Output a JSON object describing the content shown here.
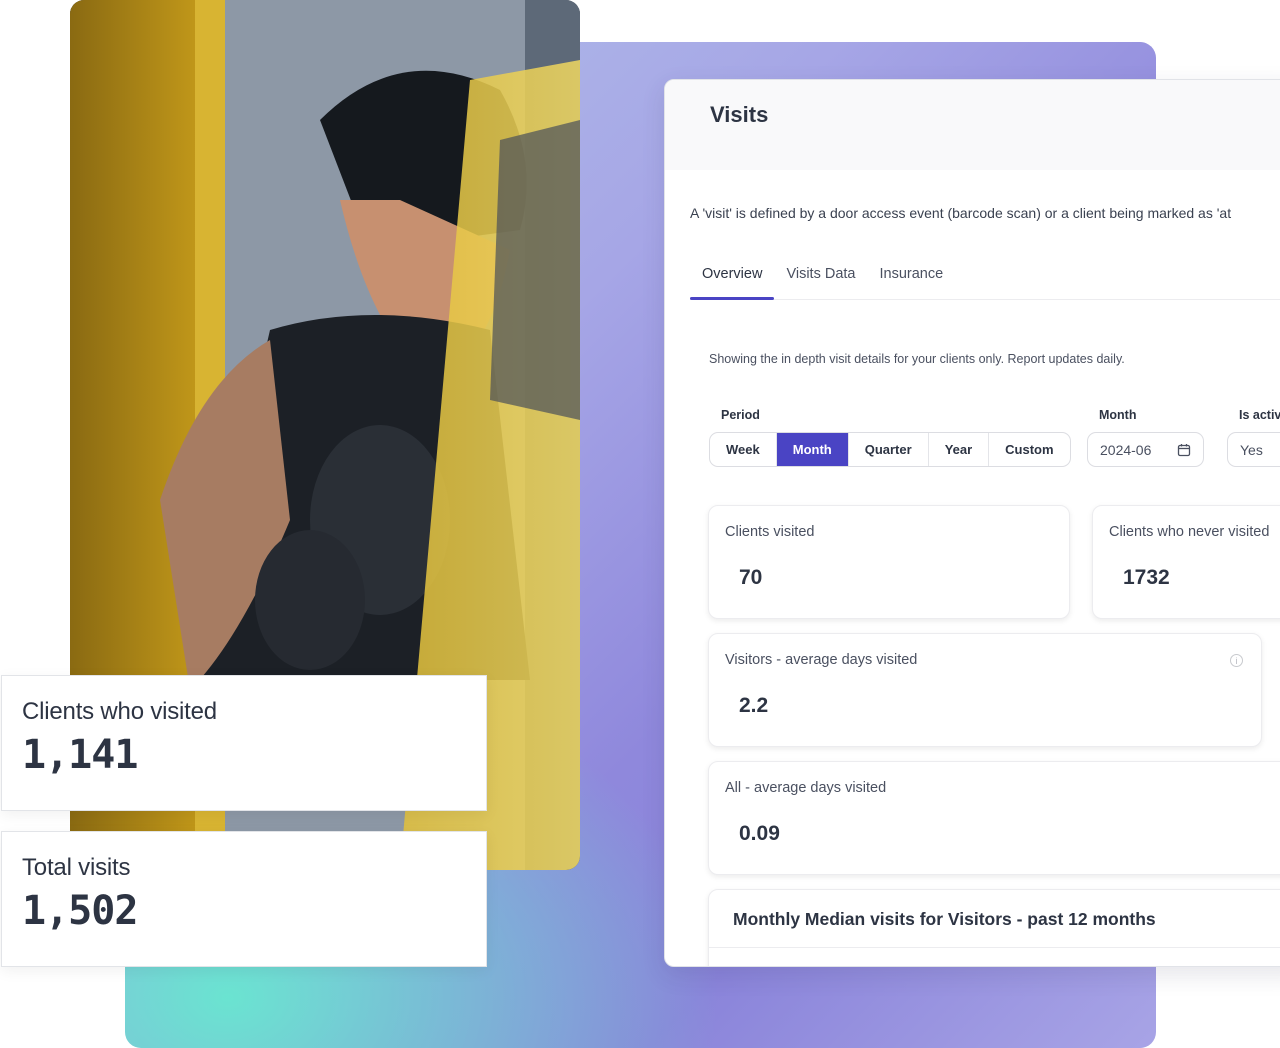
{
  "hero_stats": [
    {
      "label": "Clients who visited",
      "value": "1,141"
    },
    {
      "label": "Total visits",
      "value": "1,502"
    }
  ],
  "panel": {
    "title": "Visits",
    "description": "A 'visit' is defined by a door access event (barcode scan) or a client being marked as 'at",
    "tabs": [
      {
        "label": "Overview",
        "active": true
      },
      {
        "label": "Visits Data",
        "active": false
      },
      {
        "label": "Insurance",
        "active": false
      }
    ],
    "subtext": "Showing the in depth visit details for your clients only. Report updates daily.",
    "filters": {
      "period_label": "Period",
      "period_options": [
        "Week",
        "Month",
        "Quarter",
        "Year",
        "Custom"
      ],
      "period_selected": "Month",
      "month_label": "Month",
      "month_value": "2024-06",
      "is_active_label": "Is activ",
      "is_active_value": "Yes"
    },
    "metrics": [
      {
        "label": "Clients visited",
        "value": "70"
      },
      {
        "label": "Clients who never visited",
        "value": "1732"
      },
      {
        "label": "Visitors - average days visited",
        "value": "2.2"
      },
      {
        "label": "All - average days visited",
        "value": "0.09"
      }
    ],
    "chart_section_title": "Monthly Median visits for Visitors - past 12 months"
  },
  "colors": {
    "accent": "#4a44c4",
    "text": "#2d3443"
  }
}
